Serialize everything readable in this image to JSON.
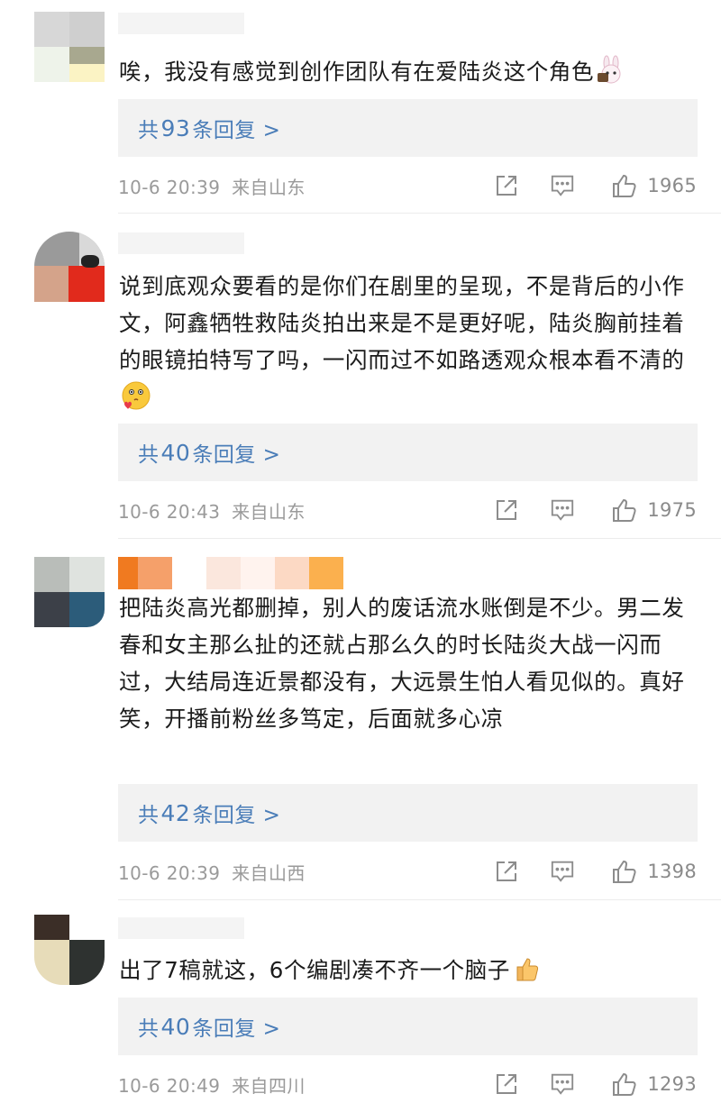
{
  "colors": {
    "reply_link": "#4a7db8",
    "meta_text": "#9a9a9a",
    "reply_box_bg": "#f2f2f2",
    "divider": "#ececec"
  },
  "icons": {
    "share": "share-icon",
    "comment": "comment-icon",
    "like": "thumbs-up-icon"
  },
  "comments": [
    {
      "text": "唉，我没有感觉到创作团队有在爱陆炎这个角色",
      "emoji": "rabbit-emoji-icon",
      "reply_prefix": "共",
      "reply_count": "93",
      "reply_suffix": "条回复 >",
      "time": "10-6 20:39",
      "location": "来自山东",
      "likes": "1965"
    },
    {
      "text": "说到底观众要看的是你们在剧里的呈现，不是背后的小作文，阿鑫牺牲救陆炎拍出来是不是更好呢，陆炎胸前挂着的眼镜拍特写了吗，一闪而过不如路透观众根本看不清的",
      "emoji": "kissing-face-emoji-icon",
      "reply_prefix": "共",
      "reply_count": "40",
      "reply_suffix": "条回复 >",
      "time": "10-6 20:43",
      "location": "来自山东",
      "likes": "1975"
    },
    {
      "text": "把陆炎高光都删掉，别人的废话流水账倒是不少。男二发春和女主那么扯的还就占那么久的时长陆炎大战一闪而过，大结局连近景都没有，大远景生怕人看见似的。真好笑，开播前粉丝多笃定，后面就多心凉",
      "emoji": "",
      "reply_prefix": "共",
      "reply_count": "42",
      "reply_suffix": "条回复 >",
      "time": "10-6 20:39",
      "location": "来自山西",
      "likes": "1398"
    },
    {
      "text": "出了7稿就这，6个编剧凑不齐一个脑子",
      "emoji": "thumbs-up-emoji-icon",
      "reply_prefix": "共",
      "reply_count": "40",
      "reply_suffix": "条回复 >",
      "time": "10-6 20:49",
      "location": "来自四川",
      "likes": "1293"
    }
  ]
}
